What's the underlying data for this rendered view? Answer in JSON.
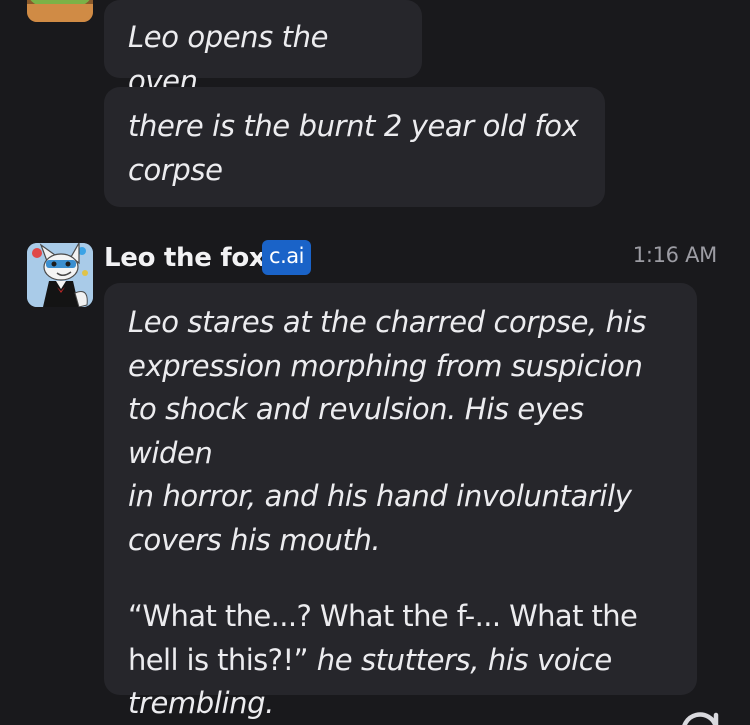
{
  "messages": [
    {
      "text": "Leo opens the oven"
    },
    {
      "lines": [
        "there is the burnt 2 year old fox",
        "corpse"
      ]
    }
  ],
  "character": {
    "name": "Leo the fox",
    "badge": "c.ai",
    "timestamp": "1:16 AM"
  },
  "reply": {
    "para1_lines": [
      "Leo stares at the charred corpse, his",
      "expression morphing from suspicion",
      "to shock and revulsion. His eyes widen",
      "in horror, and his hand involuntarily",
      "covers his mouth."
    ],
    "line1_quote": "“What the...? What the f-... What the",
    "line2_quote": "hell is this?!”",
    "line2_action": " he stutters, his voice",
    "line3_action": "trembling."
  },
  "colors": {
    "background": "#19191c",
    "bubble": "#26262b",
    "badge": "#1a63c8",
    "timestamp": "#9c9ca3"
  },
  "icons": {
    "previous_avatar": "user-avatar-icon",
    "character_avatar": "fox-avatar-icon",
    "corner": "refresh-icon"
  }
}
